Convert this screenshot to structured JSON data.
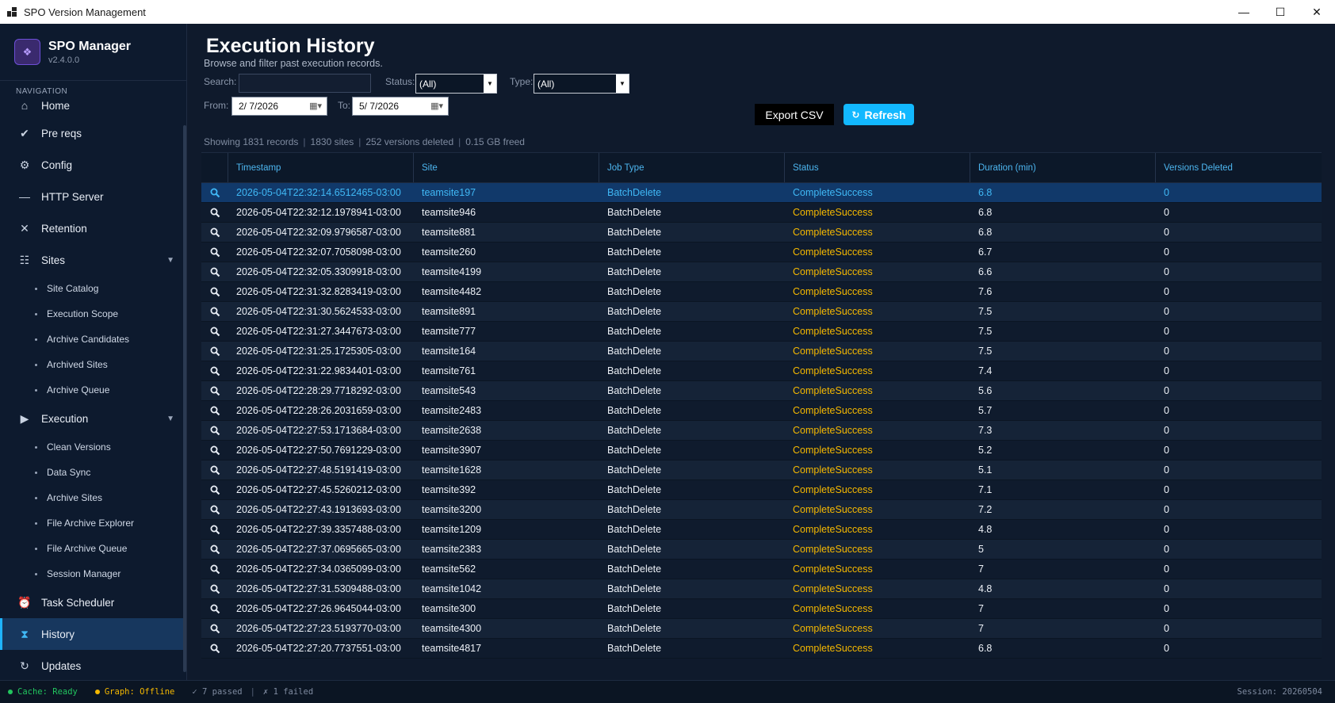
{
  "window": {
    "title": "SPO Version Management",
    "minimize": "—",
    "maximize": "☐",
    "close": "✕"
  },
  "sidebar": {
    "app_name": "SPO Manager",
    "version": "v2.4.0.0",
    "nav_heading": "NAVIGATION",
    "items": {
      "home": "Home",
      "prereqs": "Pre reqs",
      "config": "Config",
      "http": "HTTP Server",
      "retention": "Retention",
      "sites": "Sites",
      "execution": "Execution",
      "scheduler": "Task Scheduler",
      "history": "History",
      "updates": "Updates"
    },
    "sites_sub": [
      "Site Catalog",
      "Execution Scope",
      "Archive Candidates",
      "Archived Sites",
      "Archive Queue"
    ],
    "execution_sub": [
      "Clean Versions",
      "Data Sync",
      "Archive Sites",
      "File Archive Explorer",
      "File Archive Queue",
      "Session Manager"
    ]
  },
  "main": {
    "title": "Execution History",
    "subtitle": "Browse and filter past execution records.",
    "filters": {
      "search_label": "Search:",
      "search_value": "",
      "status_label": "Status:",
      "status_value": "(All)",
      "type_label": "Type:",
      "type_value": "(All)",
      "from_label": "From:",
      "from_value": "2/  7/2026",
      "to_label": "To:",
      "to_value": "5/  7/2026"
    },
    "buttons": {
      "export": "Export CSV",
      "refresh": "Refresh"
    },
    "summary": {
      "records": "Showing 1831 records",
      "sites": "1830 sites",
      "versions": "252 versions deleted",
      "freed": "0.15 GB freed"
    },
    "grid": {
      "columns": [
        "Timestamp",
        "Site",
        "Job Type",
        "Status",
        "Duration (min)",
        "Versions Deleted"
      ],
      "rows": [
        [
          "2026-05-04T22:32:14.6512465-03:00",
          "teamsite197",
          "BatchDelete",
          "CompleteSuccess",
          "6.8",
          "0"
        ],
        [
          "2026-05-04T22:32:12.1978941-03:00",
          "teamsite946",
          "BatchDelete",
          "CompleteSuccess",
          "6.8",
          "0"
        ],
        [
          "2026-05-04T22:32:09.9796587-03:00",
          "teamsite881",
          "BatchDelete",
          "CompleteSuccess",
          "6.8",
          "0"
        ],
        [
          "2026-05-04T22:32:07.7058098-03:00",
          "teamsite260",
          "BatchDelete",
          "CompleteSuccess",
          "6.7",
          "0"
        ],
        [
          "2026-05-04T22:32:05.3309918-03:00",
          "teamsite4199",
          "BatchDelete",
          "CompleteSuccess",
          "6.6",
          "0"
        ],
        [
          "2026-05-04T22:31:32.8283419-03:00",
          "teamsite4482",
          "BatchDelete",
          "CompleteSuccess",
          "7.6",
          "0"
        ],
        [
          "2026-05-04T22:31:30.5624533-03:00",
          "teamsite891",
          "BatchDelete",
          "CompleteSuccess",
          "7.5",
          "0"
        ],
        [
          "2026-05-04T22:31:27.3447673-03:00",
          "teamsite777",
          "BatchDelete",
          "CompleteSuccess",
          "7.5",
          "0"
        ],
        [
          "2026-05-04T22:31:25.1725305-03:00",
          "teamsite164",
          "BatchDelete",
          "CompleteSuccess",
          "7.5",
          "0"
        ],
        [
          "2026-05-04T22:31:22.9834401-03:00",
          "teamsite761",
          "BatchDelete",
          "CompleteSuccess",
          "7.4",
          "0"
        ],
        [
          "2026-05-04T22:28:29.7718292-03:00",
          "teamsite543",
          "BatchDelete",
          "CompleteSuccess",
          "5.6",
          "0"
        ],
        [
          "2026-05-04T22:28:26.2031659-03:00",
          "teamsite2483",
          "BatchDelete",
          "CompleteSuccess",
          "5.7",
          "0"
        ],
        [
          "2026-05-04T22:27:53.1713684-03:00",
          "teamsite2638",
          "BatchDelete",
          "CompleteSuccess",
          "7.3",
          "0"
        ],
        [
          "2026-05-04T22:27:50.7691229-03:00",
          "teamsite3907",
          "BatchDelete",
          "CompleteSuccess",
          "5.2",
          "0"
        ],
        [
          "2026-05-04T22:27:48.5191419-03:00",
          "teamsite1628",
          "BatchDelete",
          "CompleteSuccess",
          "5.1",
          "0"
        ],
        [
          "2026-05-04T22:27:45.5260212-03:00",
          "teamsite392",
          "BatchDelete",
          "CompleteSuccess",
          "7.1",
          "0"
        ],
        [
          "2026-05-04T22:27:43.1913693-03:00",
          "teamsite3200",
          "BatchDelete",
          "CompleteSuccess",
          "7.2",
          "0"
        ],
        [
          "2026-05-04T22:27:39.3357488-03:00",
          "teamsite1209",
          "BatchDelete",
          "CompleteSuccess",
          "4.8",
          "0"
        ],
        [
          "2026-05-04T22:27:37.0695665-03:00",
          "teamsite2383",
          "BatchDelete",
          "CompleteSuccess",
          "5",
          "0"
        ],
        [
          "2026-05-04T22:27:34.0365099-03:00",
          "teamsite562",
          "BatchDelete",
          "CompleteSuccess",
          "7",
          "0"
        ],
        [
          "2026-05-04T22:27:31.5309488-03:00",
          "teamsite1042",
          "BatchDelete",
          "CompleteSuccess",
          "4.8",
          "0"
        ],
        [
          "2026-05-04T22:27:26.9645044-03:00",
          "teamsite300",
          "BatchDelete",
          "CompleteSuccess",
          "7",
          "0"
        ],
        [
          "2026-05-04T22:27:23.5193770-03:00",
          "teamsite4300",
          "BatchDelete",
          "CompleteSuccess",
          "7",
          "0"
        ],
        [
          "2026-05-04T22:27:20.7737551-03:00",
          "teamsite4817",
          "BatchDelete",
          "CompleteSuccess",
          "6.8",
          "0"
        ]
      ]
    }
  },
  "statusbar": {
    "cache": "Cache: Ready",
    "graph": "Graph: Offline",
    "passed": "✓ 7 passed",
    "failed": "✗ 1 failed",
    "session": "Session: 20260504"
  },
  "colors": {
    "accent": "#12b8ff",
    "status_success": "#f5b800",
    "cache_ok": "#22c55e",
    "graph_offline": "#f5b800"
  }
}
